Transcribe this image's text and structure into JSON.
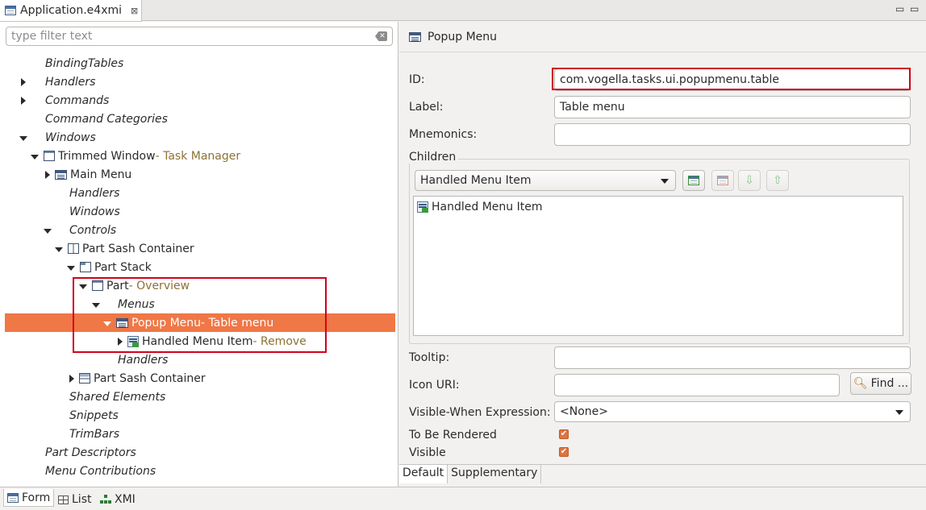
{
  "editor": {
    "tab_title": "Application.e4xmi",
    "tab_close": "⊠",
    "minimize": "▭",
    "maximize": "▭"
  },
  "left": {
    "filter_placeholder": "type filter text",
    "tree": [
      {
        "label": "BindingTables",
        "italic": true
      },
      {
        "label": "Handlers",
        "italic": true
      },
      {
        "label": "Commands",
        "italic": true
      },
      {
        "label": "Command Categories",
        "italic": true
      },
      {
        "label": "Windows",
        "italic": true
      },
      {
        "label": "Trimmed Window",
        "sub": " - Task Manager"
      },
      {
        "label": "Main Menu"
      },
      {
        "label": "Handlers",
        "italic": true
      },
      {
        "label": "Windows",
        "italic": true
      },
      {
        "label": "Controls",
        "italic": true
      },
      {
        "label": "Part Sash Container"
      },
      {
        "label": "Part Stack"
      },
      {
        "label": "Part",
        "sub": " - Overview"
      },
      {
        "label": "Menus",
        "italic": true
      },
      {
        "label": "Popup Menu",
        "sub": " - Table menu"
      },
      {
        "label": "Handled Menu Item",
        "sub": " - Remove"
      },
      {
        "label": "Handlers",
        "italic": true
      },
      {
        "label": "Part Sash Container"
      },
      {
        "label": "Shared Elements",
        "italic": true
      },
      {
        "label": "Snippets",
        "italic": true
      },
      {
        "label": "TrimBars",
        "italic": true
      },
      {
        "label": "Part Descriptors",
        "italic": true
      },
      {
        "label": "Menu Contributions",
        "italic": true
      }
    ]
  },
  "right": {
    "header_title": "Popup Menu",
    "id_label": "ID:",
    "id_value": "com.vogella.tasks.ui.popupmenu.table",
    "label_label": "Label:",
    "label_value": "Table menu",
    "mnemonics_label": "Mnemonics:",
    "mnemonics_value": "",
    "children_label": "Children",
    "children_combo": "Handled Menu Item",
    "children_items": [
      "Handled Menu Item"
    ],
    "tooltip_label": "Tooltip:",
    "tooltip_value": "",
    "icon_uri_label": "Icon URI:",
    "icon_uri_value": "",
    "find_button": "Find ...",
    "visible_when_label": "Visible-When Expression:",
    "visible_when_value": "<None>",
    "to_be_rendered_label": "To Be Rendered",
    "visible_label": "Visible",
    "check_mark": "✔",
    "subtabs": [
      "Default",
      "Supplementary"
    ]
  },
  "bottom_tabs": [
    "Form",
    "List",
    "XMI"
  ],
  "colors": {
    "selection": "#f07746",
    "highlight_box": "#d0021b",
    "sub_label": "#8c7234"
  }
}
